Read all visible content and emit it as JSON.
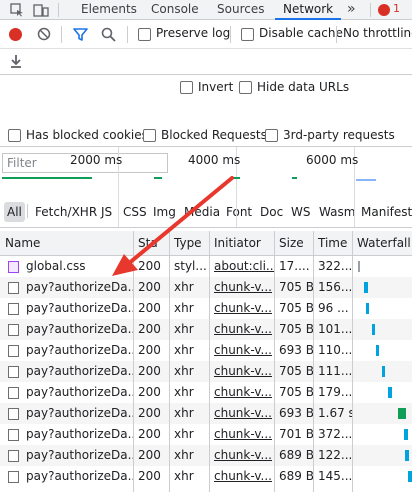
{
  "tabs": {
    "elements": "Elements",
    "console": "Console",
    "sources": "Sources",
    "network": "Network",
    "more": "»",
    "badge": "1"
  },
  "toolbar": {
    "preserve_log": "Preserve log",
    "disable_cache": "Disable cache",
    "throttling": "No throttling"
  },
  "filter": {
    "placeholder": "Filter",
    "invert": "Invert",
    "hide_data_urls": "Hide data URLs"
  },
  "types": [
    "All",
    "Fetch/XHR",
    "JS",
    "CSS",
    "Img",
    "Media",
    "Font",
    "Doc",
    "WS",
    "Wasm",
    "Manifest"
  ],
  "blocked": {
    "has_blocked_cookies": "Has blocked cookies",
    "blocked_requests": "Blocked Requests",
    "third_party": "3rd-party requests"
  },
  "overview": {
    "ticks": [
      "2000 ms",
      "4000 ms",
      "6000 ms"
    ]
  },
  "table": {
    "headers": [
      "Name",
      "Sta",
      "Type",
      "Initiator",
      "Size",
      "Time",
      "Waterfall"
    ],
    "rows": [
      {
        "name": "global.css",
        "status": "200",
        "type": "styl...",
        "initiator": "about:cli...",
        "size": "17....",
        "time": "322...",
        "icon": "css"
      },
      {
        "name": "pay?authorizeDa...",
        "status": "200",
        "type": "xhr",
        "initiator": "chunk-v...",
        "size": "705 B",
        "time": "156...",
        "icon": "doc"
      },
      {
        "name": "pay?authorizeDa...",
        "status": "200",
        "type": "xhr",
        "initiator": "chunk-v...",
        "size": "705 B",
        "time": "96 ...",
        "icon": "doc"
      },
      {
        "name": "pay?authorizeDa...",
        "status": "200",
        "type": "xhr",
        "initiator": "chunk-v...",
        "size": "705 B",
        "time": "101...",
        "icon": "doc"
      },
      {
        "name": "pay?authorizeDa...",
        "status": "200",
        "type": "xhr",
        "initiator": "chunk-v...",
        "size": "693 B",
        "time": "110...",
        "icon": "doc"
      },
      {
        "name": "pay?authorizeDa...",
        "status": "200",
        "type": "xhr",
        "initiator": "chunk-v...",
        "size": "705 B",
        "time": "111...",
        "icon": "doc"
      },
      {
        "name": "pay?authorizeDa...",
        "status": "200",
        "type": "xhr",
        "initiator": "chunk-v...",
        "size": "705 B",
        "time": "179...",
        "icon": "doc"
      },
      {
        "name": "pay?authorizeDa...",
        "status": "200",
        "type": "xhr",
        "initiator": "chunk-v...",
        "size": "693 B",
        "time": "1.67 s",
        "icon": "doc"
      },
      {
        "name": "pay?authorizeDa...",
        "status": "200",
        "type": "xhr",
        "initiator": "chunk-v...",
        "size": "701 B",
        "time": "372...",
        "icon": "doc"
      },
      {
        "name": "pay?authorizeDa...",
        "status": "200",
        "type": "xhr",
        "initiator": "chunk-v...",
        "size": "689 B",
        "time": "122...",
        "icon": "doc"
      },
      {
        "name": "pay?authorizeDa...",
        "status": "200",
        "type": "xhr",
        "initiator": "chunk-v...",
        "size": "689 B",
        "time": "145...",
        "icon": "doc"
      }
    ]
  },
  "colors": {
    "accent": "#1a73e8",
    "record": "#d93025",
    "annotation_arrow": "#e8372c",
    "waterfall_blue": "#00a3e0",
    "waterfall_green": "#0f9d58"
  }
}
